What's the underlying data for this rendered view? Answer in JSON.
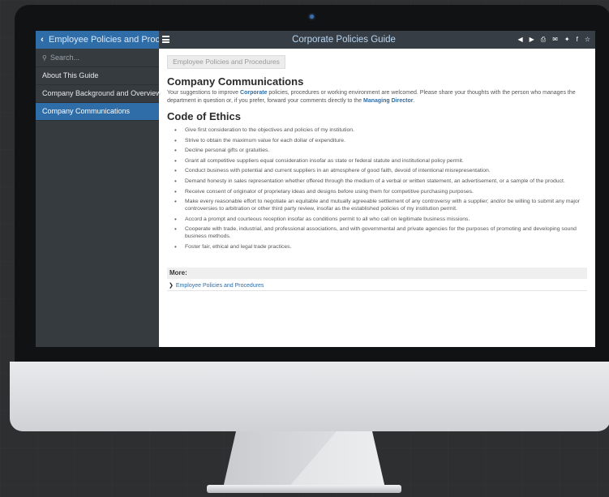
{
  "topbar": {
    "section_title": "Employee Policies and Proced...",
    "app_title": "Corporate Policies Guide",
    "icons": [
      "back-circle-icon",
      "forward-circle-icon",
      "print-icon",
      "email-icon",
      "twitter-icon",
      "facebook-icon",
      "star-icon"
    ]
  },
  "sidebar": {
    "search_placeholder": "Search...",
    "items": [
      {
        "label": "About This Guide",
        "active": false
      },
      {
        "label": "Company Background and Overview",
        "active": false
      },
      {
        "label": "Company Communications",
        "active": true
      }
    ]
  },
  "content": {
    "breadcrumb": "Employee Policies and Procedures",
    "heading": "Company Communications",
    "intro": {
      "part1": "Your suggestions to improve ",
      "link1": "Corporate",
      "part2": " policies, procedures or working environment are welcomed. Please share your thoughts with the person who manages the department in question or, if you prefer, forward your comments directly to the ",
      "link2": "Managing Director",
      "part3": "."
    },
    "ethics_heading": "Code of Ethics",
    "ethics_items": [
      "Give first consideration to the objectives and policies of my institution.",
      "Strive to obtain the maximum value for each dollar of expenditure.",
      "Decline personal gifts or gratuities.",
      "Grant all competitive suppliers equal consideration insofar as state or federal statute and institutional policy permit.",
      "Conduct business with potential and current suppliers in an atmosphere of good faith, devoid of intentional misrepresentation.",
      "Demand honesty in sales representation whether offered through the medium of a verbal or written statement, an advertisement, or a sample of the product.",
      "Receive consent of originator of proprietary ideas and designs before using them for competitive purchasing purposes.",
      "Make every reasonable effort to negotiate an equitable and mutually agreeable settlement of any controversy with a supplier; and/or be willing to submit any major controversies to arbitration or other third party review, insofar as the established policies of my institution permit.",
      "Accord a prompt and courteous reception insofar as conditions permit to all who call on legitimate business missions.",
      "Cooperate with trade, industrial, and professional associations, and with governmental and private agencies for the purposes of promoting and developing sound business methods.",
      "Foster fair, ethical and legal trade practices."
    ],
    "more_label": "More:",
    "more_link": "Employee Policies and Procedures"
  },
  "colors": {
    "accent": "#2f6da8",
    "topbar": "#373d44",
    "sidebar": "#363b40"
  }
}
